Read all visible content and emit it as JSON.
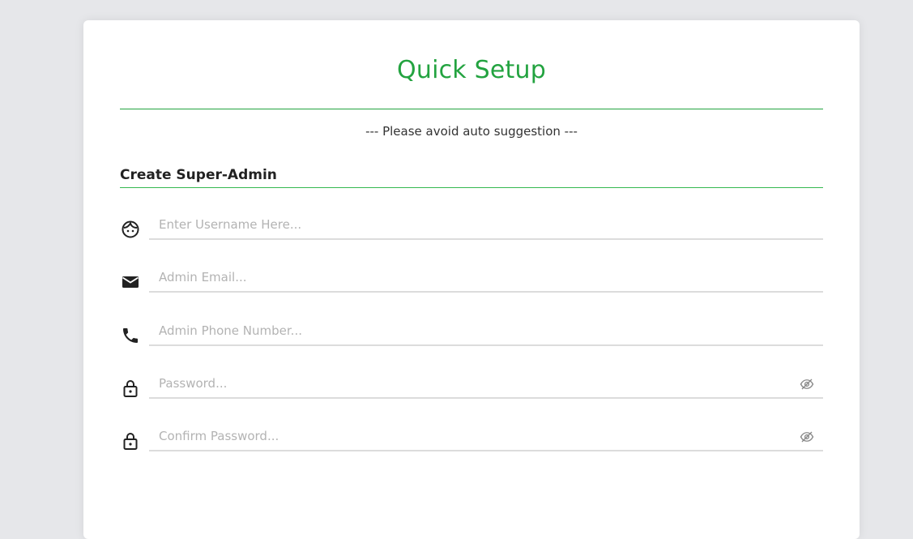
{
  "header": {
    "title": "Quick Setup",
    "notice": "--- Please avoid auto suggestion ---"
  },
  "section": {
    "title": "Create Super-Admin"
  },
  "form": {
    "username": {
      "placeholder": "Enter Username Here...",
      "icon": "face-icon"
    },
    "email": {
      "placeholder": "Admin Email...",
      "icon": "mail-icon"
    },
    "phone": {
      "placeholder": "Admin Phone Number...",
      "icon": "phone-icon"
    },
    "password": {
      "placeholder": "Password...",
      "icon": "lock-icon",
      "toggle_icon": "eye-off-icon"
    },
    "confirm_password": {
      "placeholder": "Confirm Password...",
      "icon": "lock-icon",
      "toggle_icon": "eye-off-icon"
    }
  },
  "colors": {
    "accent": "#23a340",
    "background": "#e6e7ea",
    "card": "#ffffff",
    "placeholder": "#b3b3b3",
    "underline": "#dcdcdc"
  }
}
